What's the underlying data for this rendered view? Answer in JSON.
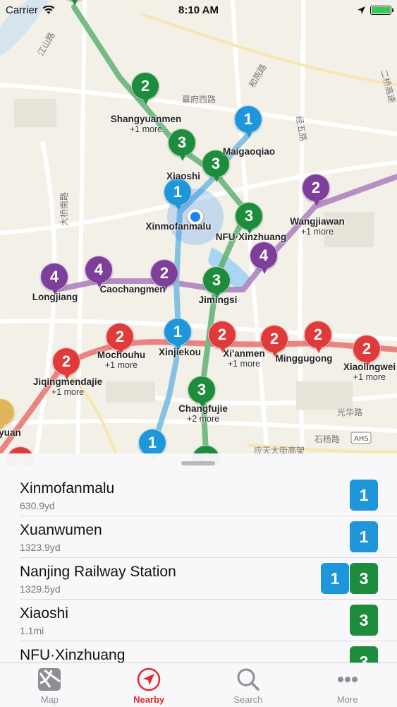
{
  "status": {
    "carrier": "Carrier",
    "time": "8:10 AM"
  },
  "map": {
    "pins": [
      {
        "n": "3",
        "c": "green"
      },
      {
        "n": "2",
        "c": "green"
      },
      {
        "n": "3",
        "c": "green"
      },
      {
        "n": "3",
        "c": "green"
      },
      {
        "n": "1",
        "c": "blue"
      },
      {
        "n": "1",
        "c": "blue"
      },
      {
        "n": "3",
        "c": "green"
      },
      {
        "n": "2",
        "c": "purple"
      },
      {
        "n": "4",
        "c": "purple"
      },
      {
        "n": "4",
        "c": "purple"
      },
      {
        "n": "4",
        "c": "purple"
      },
      {
        "n": "2",
        "c": "purple"
      },
      {
        "n": "3",
        "c": "green"
      },
      {
        "n": "1",
        "c": "blue"
      },
      {
        "n": "2",
        "c": "red"
      },
      {
        "n": "2",
        "c": "red"
      },
      {
        "n": "2",
        "c": "red"
      },
      {
        "n": "2",
        "c": "red"
      },
      {
        "n": "2",
        "c": "red"
      },
      {
        "n": "2",
        "c": "red"
      },
      {
        "n": "3",
        "c": "green"
      },
      {
        "n": "1",
        "c": "blue"
      },
      {
        "n": "2",
        "c": "red"
      },
      {
        "n": "3",
        "c": "green"
      },
      {
        "n": "",
        "c": "yellow"
      }
    ],
    "labels": [
      {
        "name": "Shangyuanmen",
        "more": "+1 more"
      },
      {
        "name": "Maigaoqiao",
        "more": ""
      },
      {
        "name": "Xiaoshi",
        "more": ""
      },
      {
        "name": "Xinmofanmalu",
        "more": ""
      },
      {
        "name": "NFU·Xinzhuang",
        "more": ""
      },
      {
        "name": "Wangjiawan",
        "more": "+1 more"
      },
      {
        "name": "Longjiang",
        "more": ""
      },
      {
        "name": "Caochangmen",
        "more": ""
      },
      {
        "name": "Jimingsi",
        "more": ""
      },
      {
        "name": "Mochouhu",
        "more": "+1 more"
      },
      {
        "name": "Xinjiekou",
        "more": ""
      },
      {
        "name": "Xi'anmen",
        "more": "+1 more"
      },
      {
        "name": "Minggugong",
        "more": ""
      },
      {
        "name": "Xiaolingwei",
        "more": "+1 more"
      },
      {
        "name": "Jiqingmendajie",
        "more": "+1 more"
      },
      {
        "name": "Changfujie",
        "more": "+2 more"
      },
      {
        "name": "yuan",
        "more": ""
      }
    ],
    "streets": [
      "幕府西路",
      "和燕路",
      "经五路",
      "江山路",
      "大桥南路",
      "光华路",
      "石杨路",
      "应天大街高架",
      "二桥高速",
      "AHS"
    ]
  },
  "nearby": [
    {
      "name": "Xinmofanmalu",
      "distance": "630.9yd",
      "lines": [
        "1"
      ]
    },
    {
      "name": "Xuanwumen",
      "distance": "1323.9yd",
      "lines": [
        "1"
      ]
    },
    {
      "name": "Nanjing Railway Station",
      "distance": "1329.5yd",
      "lines": [
        "1",
        "3"
      ]
    },
    {
      "name": "Xiaoshi",
      "distance": "1.1mi",
      "lines": [
        "3"
      ]
    },
    {
      "name": "NFU·Xinzhuang",
      "distance": "",
      "lines": [
        "3"
      ]
    }
  ],
  "tabs": [
    {
      "label": "Map",
      "icon": "map-icon"
    },
    {
      "label": "Nearby",
      "icon": "location-arrow-icon"
    },
    {
      "label": "Search",
      "icon": "search-icon"
    },
    {
      "label": "More",
      "icon": "more-dots-icon"
    }
  ],
  "colors": {
    "line1": "#1f96d9",
    "line2": "#e03a3a",
    "line3": "#1e8c3d",
    "line4": "#7d3f9a",
    "accent": "#e0282e"
  }
}
